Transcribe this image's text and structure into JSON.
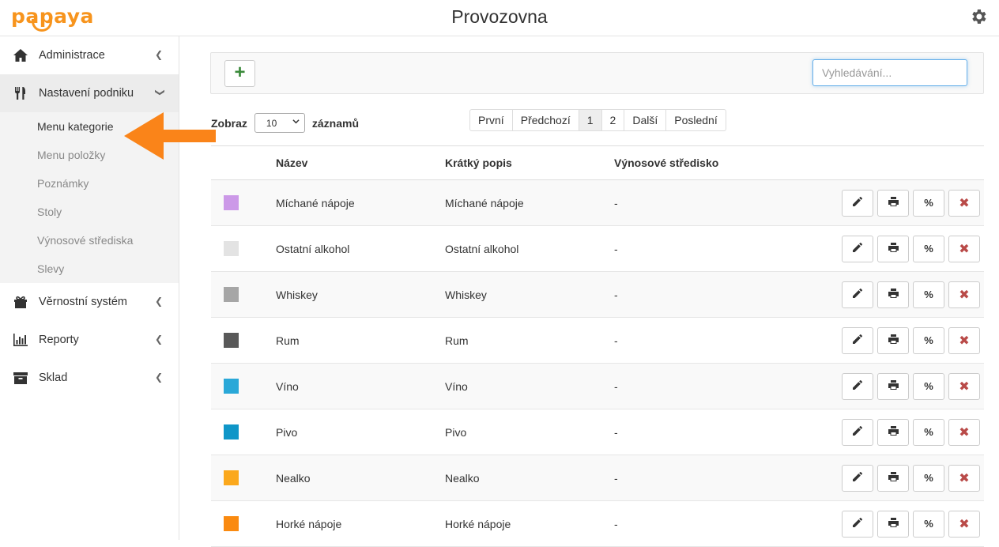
{
  "app": {
    "logo_text": "papaya",
    "page_title": "Provozovna",
    "brand_color": "#f7941d"
  },
  "sidebar": {
    "items": [
      {
        "label": "Administrace",
        "icon": "home-icon"
      },
      {
        "label": "Nastavení podniku",
        "icon": "utensils-icon",
        "expanded": true
      },
      {
        "label": "Věrnostní systém",
        "icon": "gift-icon"
      },
      {
        "label": "Reporty",
        "icon": "bar-chart-icon"
      },
      {
        "label": "Sklad",
        "icon": "archive-icon"
      }
    ],
    "submenu": [
      {
        "label": "Menu kategorie",
        "current": true
      },
      {
        "label": "Menu položky"
      },
      {
        "label": "Poznámky"
      },
      {
        "label": "Stoly"
      },
      {
        "label": "Výnosové střediska"
      },
      {
        "label": "Slevy"
      }
    ]
  },
  "toolbar": {
    "add_label": "+",
    "search_placeholder": "Vyhledávání..."
  },
  "length": {
    "prefix": "Zobraz",
    "value": "10",
    "suffix": "záznamů"
  },
  "pager": [
    {
      "label": "První"
    },
    {
      "label": "Předchozí"
    },
    {
      "label": "1",
      "active": true
    },
    {
      "label": "2"
    },
    {
      "label": "Další"
    },
    {
      "label": "Poslední"
    }
  ],
  "table": {
    "headers": {
      "name": "Název",
      "short_desc": "Krátký popis",
      "revenue_center": "Výnosové středisko"
    },
    "rows": [
      {
        "color": "#cc99e8",
        "name": "Míchané nápoje",
        "short_desc": "Míchané nápoje",
        "revenue_center": "-"
      },
      {
        "color": "#e3e3e3",
        "name": "Ostatní alkohol",
        "short_desc": "Ostatní alkohol",
        "revenue_center": "-"
      },
      {
        "color": "#a6a6a6",
        "name": "Whiskey",
        "short_desc": "Whiskey",
        "revenue_center": "-"
      },
      {
        "color": "#595959",
        "name": "Rum",
        "short_desc": "Rum",
        "revenue_center": "-"
      },
      {
        "color": "#2aa8d8",
        "name": "Víno",
        "short_desc": "Víno",
        "revenue_center": "-"
      },
      {
        "color": "#0f96c8",
        "name": "Pivo",
        "short_desc": "Pivo",
        "revenue_center": "-"
      },
      {
        "color": "#fba81c",
        "name": "Nealko",
        "short_desc": "Nealko",
        "revenue_center": "-"
      },
      {
        "color": "#fa8a10",
        "name": "Horké nápoje",
        "short_desc": "Horké nápoje",
        "revenue_center": "-"
      }
    ],
    "action_labels": {
      "discount": "%",
      "delete": "✖"
    }
  }
}
